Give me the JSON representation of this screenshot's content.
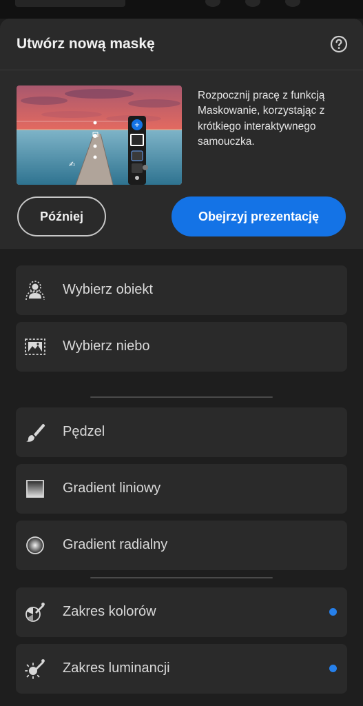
{
  "header": {
    "title": "Utwórz nową maskę",
    "help_icon": "help-circle-icon"
  },
  "promo": {
    "description": "Rozpocznij pracę z funkcją Maskowanie, korzystając z krótkiego interaktywnego samouczka.",
    "later_label": "Później",
    "watch_label": "Obejrzyj prezentację"
  },
  "groups": {
    "subject": [
      {
        "label": "Wybierz obiekt",
        "icon": "select-subject-icon"
      },
      {
        "label": "Wybierz niebo",
        "icon": "select-sky-icon"
      }
    ],
    "tools": [
      {
        "label": "Pędzel",
        "icon": "brush-icon"
      },
      {
        "label": "Gradient liniowy",
        "icon": "linear-gradient-icon"
      },
      {
        "label": "Gradient radialny",
        "icon": "radial-gradient-icon"
      }
    ],
    "range": [
      {
        "label": "Zakres kolorów",
        "icon": "color-range-icon",
        "new": true
      },
      {
        "label": "Zakres luminancji",
        "icon": "luminance-range-icon",
        "new": true
      }
    ]
  },
  "colors": {
    "accent": "#1473e6",
    "dot": "#2680eb",
    "sheet": "#2a2a2a",
    "background": "#1e1e1e"
  }
}
